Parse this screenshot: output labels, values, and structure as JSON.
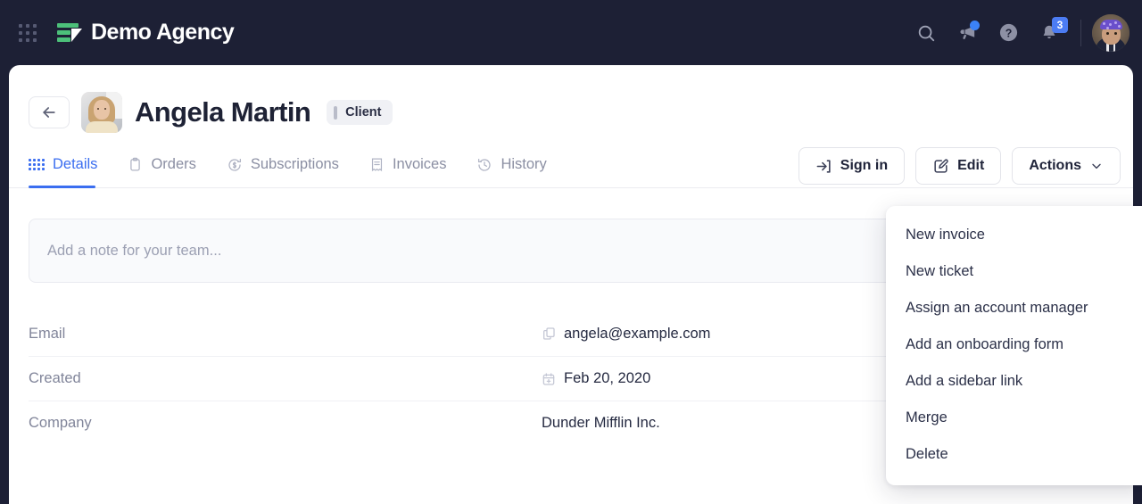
{
  "topbar": {
    "apps_icon": "grid-apps-icon",
    "brand_name": "Demo Agency",
    "icons": [
      {
        "name": "search-icon",
        "label": "Search"
      },
      {
        "name": "megaphone-icon",
        "label": "Announcements",
        "has_dot": true
      },
      {
        "name": "help-circle-icon",
        "label": "Help"
      },
      {
        "name": "bell-icon",
        "label": "Notifications",
        "badge": "3"
      }
    ],
    "notification_badge": "3",
    "avatar": "user-avatar"
  },
  "page": {
    "back_label": "Back",
    "title": "Angela Martin",
    "role_badge": "Client"
  },
  "tabs": [
    {
      "label": "Details",
      "icon": "dot-grid-icon",
      "active": true
    },
    {
      "label": "Orders",
      "icon": "clipboard-icon",
      "active": false
    },
    {
      "label": "Subscriptions",
      "icon": "refresh-dollar-icon",
      "active": false
    },
    {
      "label": "Invoices",
      "icon": "receipt-icon",
      "active": false
    },
    {
      "label": "History",
      "icon": "clock-rewind-icon",
      "active": false
    }
  ],
  "actions": {
    "sign_in": "Sign in",
    "edit": "Edit",
    "dropdown_toggle": "Actions"
  },
  "note": {
    "placeholder": "Add a note for your team...",
    "value": ""
  },
  "details": [
    {
      "label": "Email",
      "value": "angela@example.com",
      "icon": "copy-icon"
    },
    {
      "label": "Created",
      "value": "Feb 20, 2020",
      "icon": "calendar-plus-icon"
    },
    {
      "label": "Company",
      "value": "Dunder Mifflin Inc.",
      "icon": ""
    }
  ],
  "dropdown_menu": [
    "New invoice",
    "New ticket",
    "Assign an account manager",
    "Add an onboarding form",
    "Add a sidebar link",
    "Merge",
    "Delete"
  ],
  "colors": {
    "topbar_bg": "#1d2035",
    "accent_blue": "#3b6ef0",
    "brand_green": "#4cc07a",
    "badge_blue": "#4c7cf3",
    "text_dark": "#1e2235",
    "text_muted": "#8b8fa3"
  }
}
